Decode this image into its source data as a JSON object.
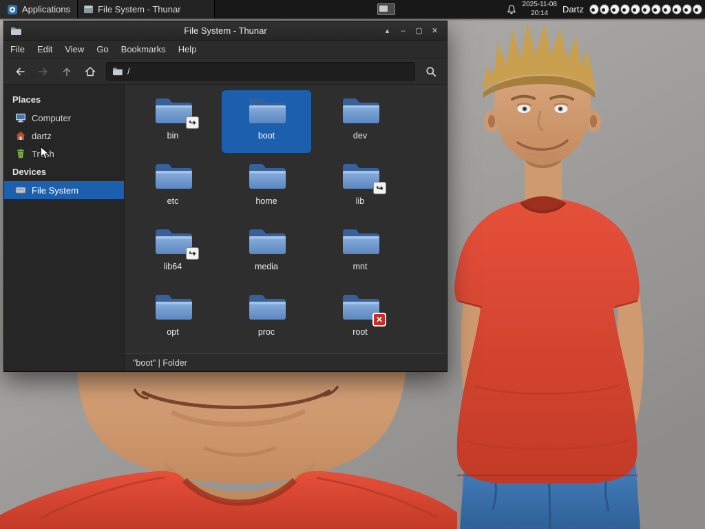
{
  "panel": {
    "applications_label": "Applications",
    "task_button_label": "File System - Thunar",
    "clock": {
      "date": "2025-11-08",
      "time": "20:14"
    },
    "user_label": "Dartz",
    "eyes_count": 11,
    "icons": [
      "applications-icon",
      "thunar-window-icon",
      "show-desktop-icon",
      "notification-bell-icon",
      "eye-icon"
    ]
  },
  "window": {
    "title": "File System - Thunar",
    "controls": {
      "shade": "▴",
      "minimize": "–",
      "maximize": "▢",
      "close": "✕"
    },
    "menu": [
      "File",
      "Edit",
      "View",
      "Go",
      "Bookmarks",
      "Help"
    ],
    "toolbar": {
      "path": "/",
      "buttons": [
        {
          "icon": "back-arrow-icon",
          "enabled": true
        },
        {
          "icon": "forward-arrow-icon",
          "enabled": false
        },
        {
          "icon": "up-arrow-icon",
          "enabled": false
        },
        {
          "icon": "home-icon",
          "enabled": true
        },
        {
          "icon": "search-icon",
          "enabled": true
        }
      ]
    },
    "sidebar": {
      "places_header": "Places",
      "places": [
        {
          "label": "Computer",
          "icon": "computer-icon"
        },
        {
          "label": "dartz",
          "icon": "home-icon"
        },
        {
          "label": "Trash",
          "icon": "trash-icon"
        }
      ],
      "devices_header": "Devices",
      "devices": [
        {
          "label": "File System",
          "icon": "drive-icon",
          "selected": true
        }
      ]
    },
    "files": [
      {
        "name": "bin",
        "emblem": "link"
      },
      {
        "name": "boot",
        "emblem": "",
        "selected": true
      },
      {
        "name": "dev",
        "emblem": ""
      },
      {
        "name": "etc",
        "emblem": ""
      },
      {
        "name": "home",
        "emblem": ""
      },
      {
        "name": "lib",
        "emblem": "link"
      },
      {
        "name": "lib64",
        "emblem": "link"
      },
      {
        "name": "media",
        "emblem": ""
      },
      {
        "name": "mnt",
        "emblem": ""
      },
      {
        "name": "opt",
        "emblem": ""
      },
      {
        "name": "proc",
        "emblem": ""
      },
      {
        "name": "root",
        "emblem": "no-access"
      }
    ],
    "statusbar": "\"boot\" | Folder"
  },
  "colors": {
    "selection_blue": "#1b5fae",
    "folder_blue": "#6f9bd4",
    "panel_bg": "#181818",
    "window_bg": "#2d2d2d",
    "shirt_red": "#d84a35",
    "jeans_blue": "#3d7ec6"
  }
}
